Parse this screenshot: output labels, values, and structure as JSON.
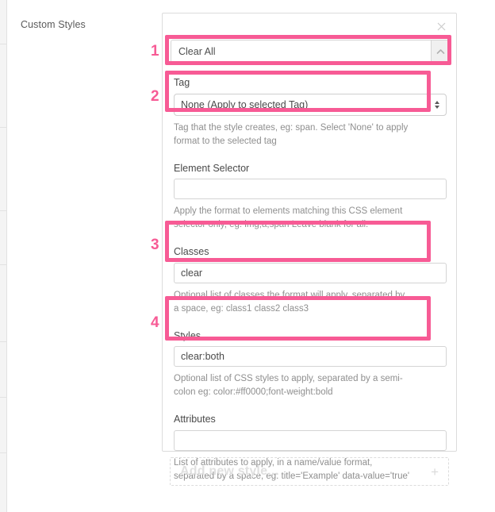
{
  "sidebar": {
    "section_label": "Custom Styles"
  },
  "panel": {
    "close_icon": "close-icon",
    "accordion": {
      "title": "Clear All",
      "toggle_icon": "chevron-up-icon"
    },
    "fields": [
      {
        "key": "tag",
        "label": "Tag",
        "type": "select",
        "value": "None (Apply to selected Tag)",
        "options": [
          "None (Apply to selected Tag)"
        ],
        "help": "Tag that the style creates, eg: span. Select 'None' to apply format to the selected tag"
      },
      {
        "key": "element_selector",
        "label": "Element Selector",
        "type": "text",
        "value": "",
        "placeholder": "",
        "help": "Apply the format to elements matching this CSS element selector only, eg: img,a,span Leave blank for all."
      },
      {
        "key": "classes",
        "label": "Classes",
        "type": "text",
        "value": "clear",
        "placeholder": "",
        "help": "Optional list of classes the format will apply, separated by a space, eg: class1 class2 class3"
      },
      {
        "key": "styles",
        "label": "Styles",
        "type": "text",
        "value": "clear:both",
        "placeholder": "",
        "help": "Optional list of CSS styles to apply, separated by a semi-colon eg: color:#ff0000;font-weight:bold"
      },
      {
        "key": "attributes",
        "label": "Attributes",
        "type": "text",
        "value": "",
        "placeholder": "",
        "help": "List of attributes to apply, in a name/value format, separated by a space, eg: title='Example' data-value='true'"
      }
    ]
  },
  "add_new": {
    "label": "Add new style...",
    "plus_icon": "plus-icon",
    "plus_glyph": "+"
  },
  "annotations": {
    "accent_color": "#f75b95",
    "markers": [
      {
        "number": "1",
        "target": "accordion-header"
      },
      {
        "number": "2",
        "target": "tag-field"
      },
      {
        "number": "3",
        "target": "classes-field"
      },
      {
        "number": "4",
        "target": "styles-field"
      }
    ]
  }
}
